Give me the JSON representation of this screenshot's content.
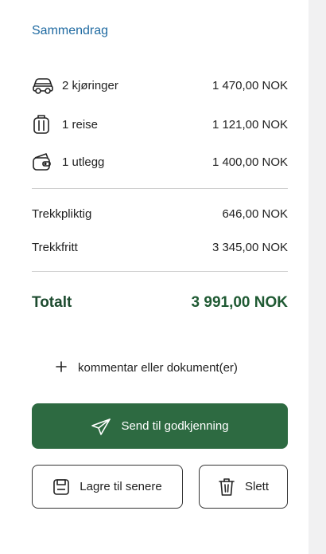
{
  "summary": {
    "title": "Sammendrag",
    "items": [
      {
        "icon": "car-icon",
        "label": "2 kjøringer",
        "amount": "1 470,00 NOK"
      },
      {
        "icon": "suitcase-icon",
        "label": "1 reise",
        "amount": "1 121,00 NOK"
      },
      {
        "icon": "wallet-icon",
        "label": "1 utlegg",
        "amount": "1 400,00 NOK"
      }
    ],
    "tax": [
      {
        "label": "Trekkpliktig",
        "amount": "646,00 NOK"
      },
      {
        "label": "Trekkfritt",
        "amount": "3 345,00 NOK"
      }
    ],
    "total": {
      "label": "Totalt",
      "amount": "3 991,00 NOK"
    }
  },
  "actions": {
    "add_comment_icon": "plus-icon",
    "add_comment_label": "kommentar eller dokument(er)",
    "send_icon": "paper-plane-icon",
    "send_label": "Send til godkjenning",
    "save_icon": "floppy-disk-icon",
    "save_label": "Lagre til senere",
    "delete_icon": "trash-icon",
    "delete_label": "Slett"
  },
  "colors": {
    "title": "#1f6aa1",
    "total": "#1d4b2f",
    "primary_button": "#2d6a41",
    "background": "#f1f1f2"
  }
}
